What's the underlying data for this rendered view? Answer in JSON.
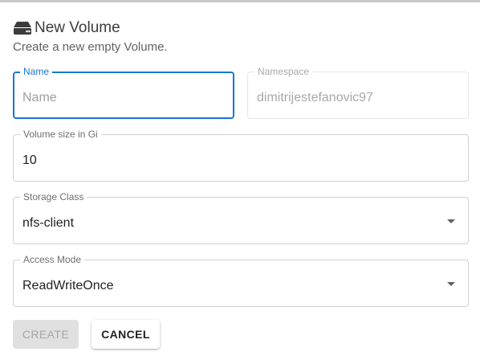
{
  "dialog": {
    "title": "New Volume",
    "subtitle": "Create a new empty Volume.",
    "icon": "hard-drive-icon"
  },
  "fields": {
    "name": {
      "label": "Name",
      "value": "",
      "placeholder": "Name"
    },
    "namespace": {
      "label": "Namespace",
      "value": "dimitrijestefanovic97"
    },
    "volume_size": {
      "label": "Volume size in Gi",
      "value": "10"
    },
    "storage_class": {
      "label": "Storage Class",
      "value": "nfs-client"
    },
    "access_mode": {
      "label": "Access Mode",
      "value": "ReadWriteOnce"
    }
  },
  "actions": {
    "create_label": "CREATE",
    "cancel_label": "CANCEL"
  },
  "colors": {
    "accent": "#1976d2",
    "disabled_button_bg": "#e0e0e0",
    "disabled_text": "#a6a6a6"
  }
}
